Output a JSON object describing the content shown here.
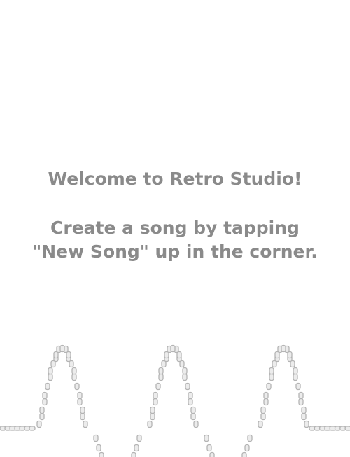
{
  "welcome": {
    "title": "Welcome to Retro Studio!",
    "instruction_line1": "Create a song by tapping",
    "instruction_line2": "\"New Song\" up in the corner."
  },
  "colors": {
    "text": "#8a8a8a",
    "wave_stroke": "#b4b4b4",
    "wave_fill": "#ececec",
    "background": "#ffffff"
  },
  "decoration": {
    "type": "retro-waveform",
    "peaks": 3
  }
}
